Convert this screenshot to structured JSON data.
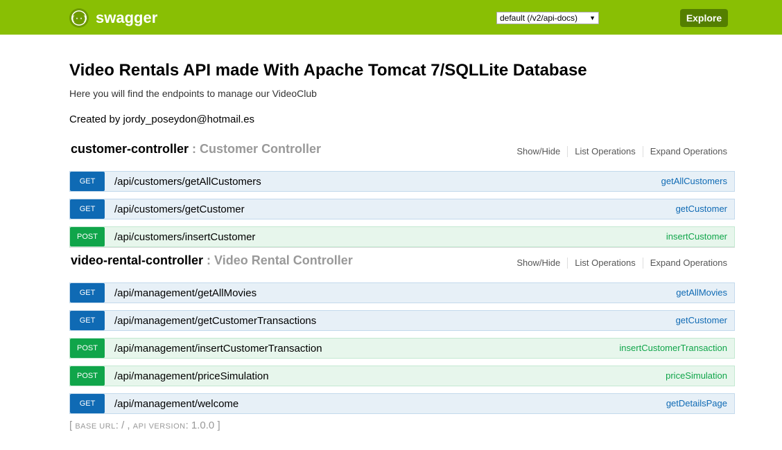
{
  "header": {
    "logo_text": "swagger",
    "spec_selected": "default (/v2/api-docs)",
    "explore_label": "Explore",
    "brand_color": "#89bf04"
  },
  "info": {
    "title": "Video Rentals API made With Apache Tomcat 7/SQLLite Database",
    "description": "Here you will find the endpoints to manage our VideoClub",
    "contact": "Created by jordy_poseydon@hotmail.es"
  },
  "resources": [
    {
      "name": "customer-controller",
      "separator": " : ",
      "description": "Customer Controller",
      "options": [
        "Show/Hide",
        "List Operations",
        "Expand Operations"
      ],
      "operations": [
        {
          "method": "GET",
          "path": "/api/customers/getAllCustomers",
          "nickname": "getAllCustomers"
        },
        {
          "method": "GET",
          "path": "/api/customers/getCustomer",
          "nickname": "getCustomer"
        },
        {
          "method": "POST",
          "path": "/api/customers/insertCustomer",
          "nickname": "insertCustomer"
        }
      ]
    },
    {
      "name": "video-rental-controller",
      "separator": " : ",
      "description": "Video Rental Controller",
      "options": [
        "Show/Hide",
        "List Operations",
        "Expand Operations"
      ],
      "operations": [
        {
          "method": "GET",
          "path": "/api/management/getAllMovies",
          "nickname": "getAllMovies"
        },
        {
          "method": "GET",
          "path": "/api/management/getCustomerTransactions",
          "nickname": "getCustomer"
        },
        {
          "method": "POST",
          "path": "/api/management/insertCustomerTransaction",
          "nickname": "insertCustomerTransaction"
        },
        {
          "method": "POST",
          "path": "/api/management/priceSimulation",
          "nickname": "priceSimulation"
        },
        {
          "method": "GET",
          "path": "/api/management/welcome",
          "nickname": "getDetailsPage"
        }
      ]
    }
  ],
  "footer": {
    "open": "[ ",
    "base_url_label": "BASE URL",
    "base_url_value": ": / , ",
    "api_version_label": "API VERSION",
    "api_version_value": ": 1.0.0 ]"
  },
  "colors": {
    "get": "#0f6ab4",
    "post": "#10a54a"
  }
}
